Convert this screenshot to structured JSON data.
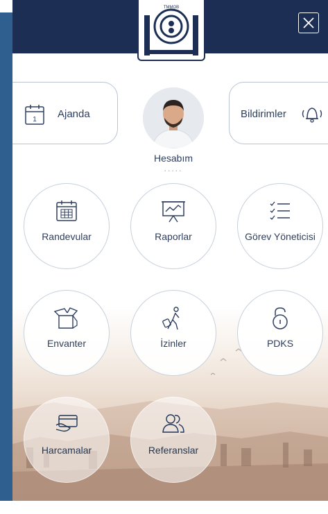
{
  "header": {
    "logo_text": "TMMOB MAKİNA MÜHENDİSLERİ ODASI",
    "close_icon": "close-icon",
    "colors": {
      "navy": "#1c2e54",
      "text": "#2d3e5e"
    }
  },
  "quick": {
    "agenda": {
      "label": "Ajanda",
      "icon": "calendar-icon",
      "day": "1"
    },
    "notifications": {
      "label": "Bildirimler",
      "icon": "bell-icon"
    }
  },
  "profile": {
    "label": "Hesabım",
    "dots": "....."
  },
  "menu": [
    {
      "label": "Randevular",
      "icon": "calendar-grid-icon"
    },
    {
      "label": "Raporlar",
      "icon": "presentation-chart-icon"
    },
    {
      "label": "Görev Yöneticisi",
      "icon": "checklist-icon"
    },
    {
      "label": "Envanter",
      "icon": "open-box-icon"
    },
    {
      "label": "İzinler",
      "icon": "walking-traveler-icon"
    },
    {
      "label": "PDKS",
      "icon": "unlock-icon"
    },
    {
      "label": "Harcamalar",
      "icon": "credit-card-icon"
    },
    {
      "label": "Referanslar",
      "icon": "users-icon"
    }
  ]
}
